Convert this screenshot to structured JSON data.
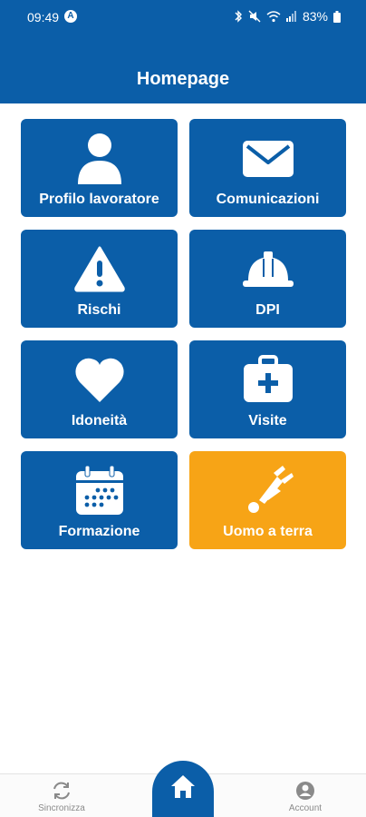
{
  "status_bar": {
    "time": "09:49",
    "app_badge": "A",
    "battery": "83%"
  },
  "header": {
    "title": "Homepage",
    "background": "#0b5ea8"
  },
  "tiles": [
    {
      "label": "Profilo lavoratore",
      "icon": "user-icon",
      "color": "#0b5ea8"
    },
    {
      "label": "Comunicazioni",
      "icon": "mail-icon",
      "color": "#0b5ea8"
    },
    {
      "label": "Rischi",
      "icon": "warning-icon",
      "color": "#0b5ea8"
    },
    {
      "label": "DPI",
      "icon": "hard-hat-icon",
      "color": "#0b5ea8"
    },
    {
      "label": "Idoneità",
      "icon": "heart-icon",
      "color": "#0b5ea8"
    },
    {
      "label": "Visite",
      "icon": "medical-kit-icon",
      "color": "#0b5ea8"
    },
    {
      "label": "Formazione",
      "icon": "calendar-icon",
      "color": "#0b5ea8"
    },
    {
      "label": "Uomo a terra",
      "icon": "man-down-icon",
      "color": "#f7a416"
    }
  ],
  "bottom_nav": {
    "sync_label": "Sincronizza",
    "home_icon": "home-icon",
    "account_label": "Account"
  }
}
